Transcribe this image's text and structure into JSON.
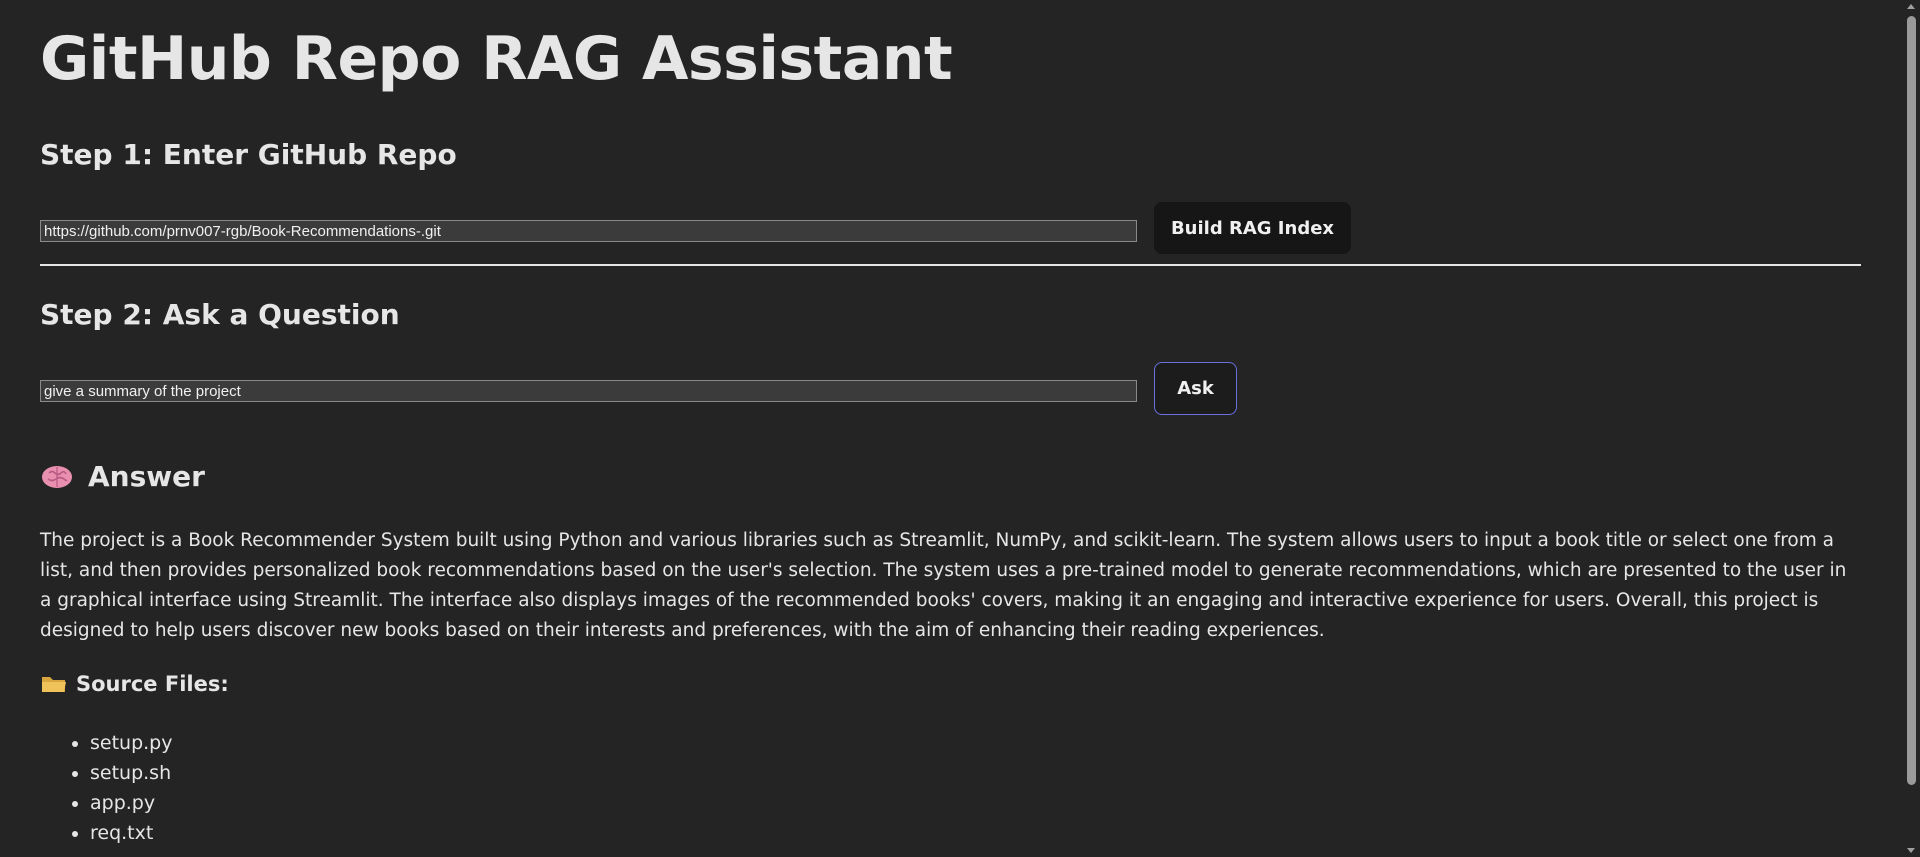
{
  "app": {
    "title": "GitHub Repo RAG Assistant"
  },
  "step1": {
    "heading": "Step 1: Enter GitHub Repo",
    "repo_url": "https://github.com/prnv007-rgb/Book-Recommendations-.git",
    "build_label": "Build RAG Index"
  },
  "step2": {
    "heading": "Step 2: Ask a Question",
    "question": "give a summary of the project",
    "ask_label": "Ask"
  },
  "answer": {
    "icon": "brain-icon",
    "heading": "Answer",
    "text": "The project is a Book Recommender System built using Python and various libraries such as Streamlit, NumPy, and scikit-learn. The system allows users to input a book title or select one from a list, and then provides personalized book recommendations based on the user's selection. The system uses a pre-trained model to generate recommendations, which are presented to the user in a graphical interface using Streamlit. The interface also displays images of the recommended books' covers, making it an engaging and interactive experience for users. Overall, this project is designed to help users discover new books based on their interests and preferences, with the aim of enhancing their reading experiences."
  },
  "sources": {
    "icon": "folder-icon",
    "heading": "Source Files:",
    "files": [
      "setup.py",
      "setup.sh",
      "app.py",
      "req.txt"
    ]
  },
  "colors": {
    "background": "#242424",
    "text": "#e6e6e6",
    "input_bg": "#3b3b3b",
    "ask_border": "#6a70e0",
    "build_bg": "#161616"
  }
}
